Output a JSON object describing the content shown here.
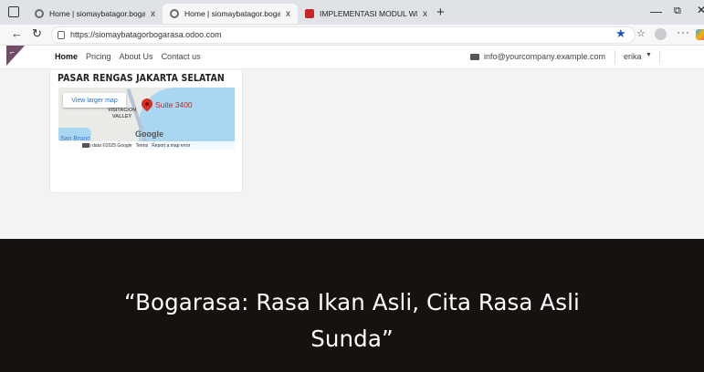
{
  "browser": {
    "tabs": [
      {
        "title": "Home | siomaybatagor.bogarasa",
        "active": false
      },
      {
        "title": "Home | siomaybatagor.bogarasa",
        "active": true
      },
      {
        "title": "IMPLEMENTASI MODUL WEBSITE",
        "active": false
      }
    ],
    "tab_close_label": "x",
    "new_tab_label": "+",
    "url": "https://siomaybatagorbogarasa.odoo.com"
  },
  "site": {
    "menu": [
      "Home",
      "Pricing",
      "About Us",
      "Contact us"
    ],
    "email": "info@yourcompany.example.com",
    "user": "erika"
  },
  "content": {
    "card_title": "PASAR RENGAS JAKARTA SELATAN",
    "map": {
      "view_larger": "View larger map",
      "area_label_1": "VISITACION",
      "area_label_2": "VALLEY",
      "pin_label": "Suite 3400",
      "google_logo": "Google",
      "city_label": "San Bruno",
      "attribution": "Map data ©2025 Google",
      "terms": "Terms",
      "report": "Report a map error"
    }
  },
  "banner": {
    "line1": "“Bogarasa: Rasa Ikan Asli, Cita Rasa Asli",
    "line2": "Sunda”"
  },
  "colors": {
    "brand": "#714b67",
    "banner_bg": "#151210",
    "star": "#1a56c9"
  }
}
